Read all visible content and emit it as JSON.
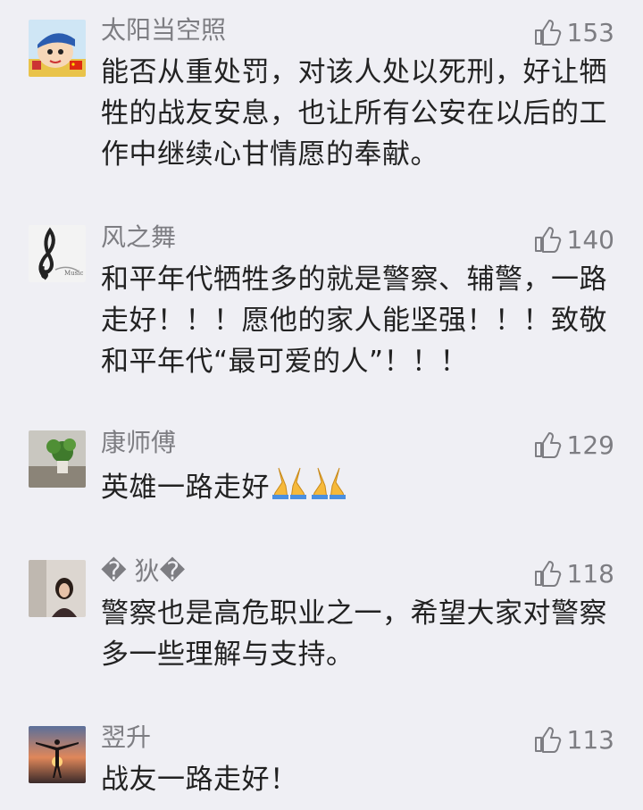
{
  "comments": [
    {
      "author": "太阳当空照",
      "likes": "153",
      "text": "能否从重处罚，对该人处以死刑，好让牺牲的战友安息，也让所有公安在以后的工作中继续心甘情愿的奉献。",
      "avatar_icon": "cartoon-avatar-icon"
    },
    {
      "author": "风之舞",
      "likes": "140",
      "text": "和平年代牺牲多的就是警察、辅警，一路走好！！！愿他的家人能坚强！！！致敬和平年代“最可爱的人”！！！",
      "avatar_icon": "music-clef-avatar-icon"
    },
    {
      "author": "康师傅",
      "likes": "129",
      "text": "英雄一路走好",
      "emoji": "🙏🙏",
      "avatar_icon": "plant-photo-avatar-icon"
    },
    {
      "author": "� 狄�",
      "likes": "118",
      "text": "警察也是高危职业之一，希望大家对警察多一些理解与支持。",
      "avatar_icon": "portrait-photo-avatar-icon"
    },
    {
      "author": "翌升",
      "likes": "113",
      "text": "战友一路走好！",
      "avatar_icon": "sunset-silhouette-avatar-icon"
    }
  ],
  "colors": {
    "background": "#efeff4",
    "meta": "#7d7d82",
    "text": "#222222"
  }
}
